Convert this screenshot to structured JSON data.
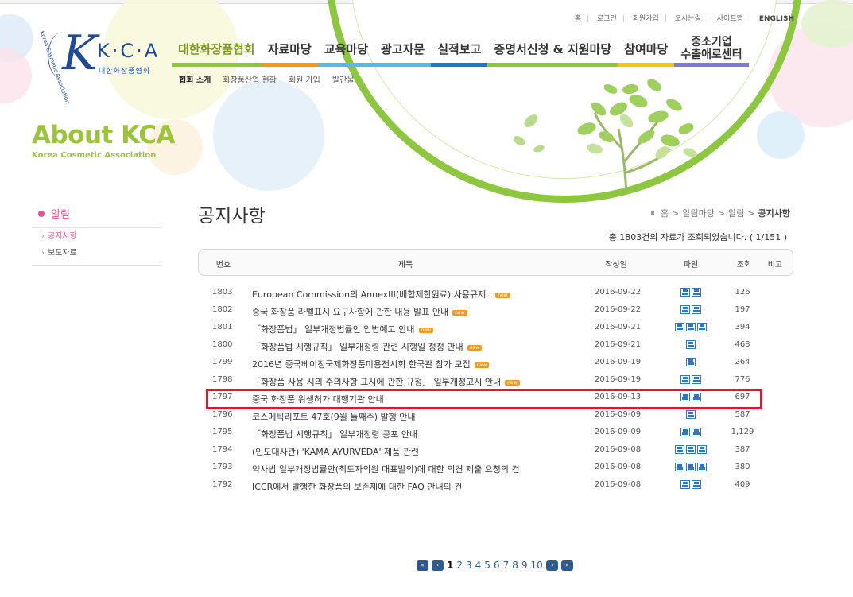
{
  "site": {
    "logo_kca": "K·C·A",
    "logo_korean": "대한화장품협회",
    "logo_arc_text": "Korea Cosmetic Association"
  },
  "util_links": [
    "홈",
    "로그인",
    "회원가입",
    "오시는길",
    "사이트맵",
    "ENGLISH"
  ],
  "gnb": [
    {
      "label": "대한화장품협회",
      "active": true,
      "bar_color": "#8dc63f"
    },
    {
      "label": "자료마당",
      "active": false,
      "bar_color": "#f3961c"
    },
    {
      "label": "교육마당",
      "active": false,
      "bar_color": "#5bb7e5"
    },
    {
      "label": "광고자문",
      "active": false,
      "bar_color": "#5bb7e5"
    },
    {
      "label": "실적보고",
      "active": false,
      "bar_color": "#1f78c1"
    },
    {
      "label": "증명서신청 & 지원마당",
      "active": false,
      "bar_color": "#8dc63f"
    },
    {
      "label": "참여마당",
      "active": false,
      "bar_color": "#f5c318"
    },
    {
      "label_line1": "중소기업",
      "label_line2": "수출애로센터",
      "active": false,
      "bar_color": "#7d7dd6"
    }
  ],
  "sub_nav": [
    {
      "label": "협회 소개",
      "active": true
    },
    {
      "label": "화장품산업 현황",
      "active": false
    },
    {
      "label": "회원 가입",
      "active": false
    },
    {
      "label": "발간물",
      "active": false
    }
  ],
  "about": {
    "title": "About KCA",
    "subtitle": "Korea Cosmetic Association"
  },
  "lnb": {
    "heading": "알림",
    "items": [
      {
        "label": "공지사항",
        "active": true
      },
      {
        "label": "보도자료",
        "active": false
      }
    ]
  },
  "page_title": "공지사항",
  "breadcrumb": [
    "홈",
    ">",
    "알림마당",
    ">",
    "알림",
    ">",
    "공지사항"
  ],
  "total_text": "총 1803건의 자료가 조회되었습니다. ( 1/151 )",
  "table": {
    "headers": {
      "no": "번호",
      "title": "제목",
      "date": "작성일",
      "file": "파일",
      "views": "조회",
      "note": "비고"
    },
    "new_badge": "new",
    "rows": [
      {
        "no": "1803",
        "title": "European Commission의 AnnexIII(배합제한원료) 사용규제..",
        "new": true,
        "date": "2016-09-22",
        "files": 2,
        "views": "126"
      },
      {
        "no": "1802",
        "title": "중국 화장품 라벨표시 요구사항에 관한 내용 발표 안내",
        "new": true,
        "date": "2016-09-22",
        "files": 2,
        "views": "197"
      },
      {
        "no": "1801",
        "title": "「화장품법」 일부개정법률안 입법예고 안내",
        "new": true,
        "date": "2016-09-21",
        "files": 3,
        "views": "394"
      },
      {
        "no": "1800",
        "title": "「화장품법 시행규칙」 일부개정령 관련 시행일 정정 안내",
        "new": true,
        "date": "2016-09-21",
        "files": 1,
        "views": "468"
      },
      {
        "no": "1799",
        "title": "2016년 중국베이징국제화장품미용전시회 한국관 참가 모집",
        "new": true,
        "date": "2016-09-19",
        "files": 1,
        "views": "264"
      },
      {
        "no": "1798",
        "title": "「화장품 사용 시의 주의사항 표시에 관한 규정」 일부개정고시 안내",
        "new": true,
        "date": "2016-09-19",
        "files": 2,
        "views": "776"
      },
      {
        "no": "1797",
        "title": "중국 화장품 위생허가 대행기관 안내",
        "new": false,
        "date": "2016-09-13",
        "files": 2,
        "views": "697"
      },
      {
        "no": "1796",
        "title": "코스메틱리포트 47호(9월 둘째주) 발행 안내",
        "new": false,
        "date": "2016-09-09",
        "files": 1,
        "views": "587"
      },
      {
        "no": "1795",
        "title": "「화장품법 시행규칙」 일부개정령 공포 안내",
        "new": false,
        "date": "2016-09-09",
        "files": 2,
        "views": "1,129"
      },
      {
        "no": "1794",
        "title": "(인도대사관) 'KAMA AYURVEDA' 제품 관련",
        "new": false,
        "date": "2016-09-08",
        "files": 3,
        "views": "387"
      },
      {
        "no": "1793",
        "title": "약사법 일부개정법률안(최도자의원 대표발의)에 대한 의견 제출 요청의 건",
        "new": false,
        "date": "2016-09-08",
        "files": 3,
        "views": "380"
      },
      {
        "no": "1792",
        "title": "ICCR에서 발행한 화장품의 보존제에 대한 FAQ 안내의 건",
        "new": false,
        "date": "2016-09-08",
        "files": 2,
        "views": "409"
      }
    ]
  },
  "pagination": {
    "first": "«",
    "prev": "‹",
    "next": "›",
    "last": "»",
    "pages": [
      "1",
      "2",
      "3",
      "4",
      "5",
      "6",
      "7",
      "8",
      "9",
      "10"
    ],
    "current": "1"
  },
  "highlight_color": "#e0162b"
}
